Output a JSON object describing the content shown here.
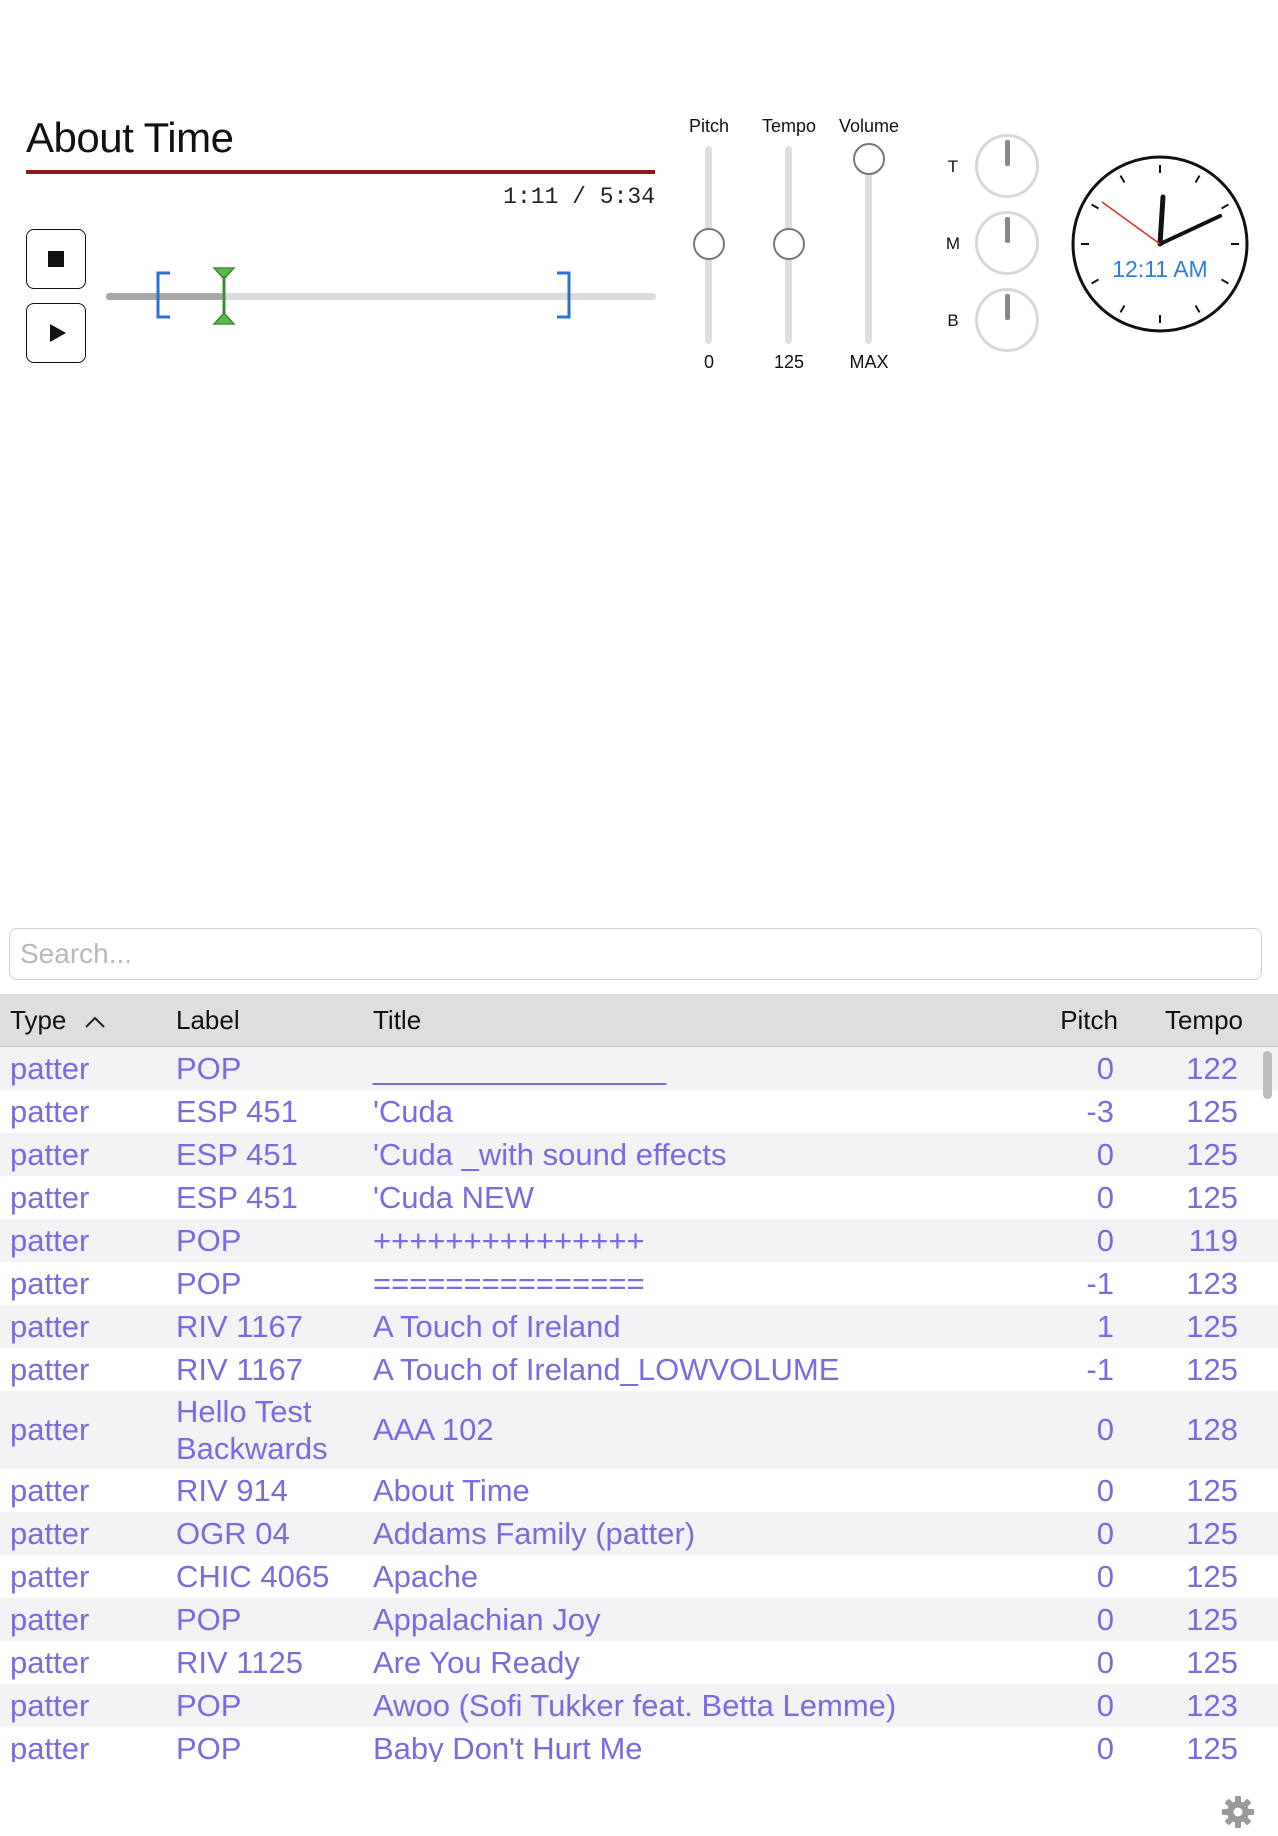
{
  "player": {
    "title": "About Time",
    "time": "1:11 / 5:34",
    "elapsed": "1:11",
    "duration": "5:34",
    "progress_fraction": 0.25,
    "loop_start_fraction": 0.1,
    "loop_end_fraction": 0.84,
    "stop_icon": "stop-icon",
    "play_icon": "play-icon"
  },
  "sliders": [
    {
      "label": "Pitch",
      "value": "0",
      "level": 0.5
    },
    {
      "label": "Tempo",
      "value": "125",
      "level": 0.5
    },
    {
      "label": "Volume",
      "value": "MAX",
      "level": 1.0
    }
  ],
  "eq": [
    {
      "label": "T"
    },
    {
      "label": "M"
    },
    {
      "label": "B"
    }
  ],
  "clock": {
    "time_text": "12:11 AM"
  },
  "search": {
    "placeholder": "Search...",
    "value": ""
  },
  "table": {
    "columns": {
      "type": "Type",
      "label": "Label",
      "title": "Title",
      "pitch": "Pitch",
      "tempo": "Tempo"
    },
    "sort_icon": "chevron-up-icon",
    "rows": [
      {
        "type": "patter",
        "label": "POP",
        "title": "_________________",
        "pitch": "0",
        "tempo": "122"
      },
      {
        "type": "patter",
        "label": "ESP 451",
        "title": "'Cuda",
        "pitch": "-3",
        "tempo": "125"
      },
      {
        "type": "patter",
        "label": "ESP 451",
        "title": "'Cuda _with sound effects",
        "pitch": "0",
        "tempo": "125"
      },
      {
        "type": "patter",
        "label": "ESP 451",
        "title": "'Cuda NEW",
        "pitch": "0",
        "tempo": "125"
      },
      {
        "type": "patter",
        "label": "POP",
        "title": "+++++++++++++++",
        "pitch": "0",
        "tempo": "119"
      },
      {
        "type": "patter",
        "label": "POP",
        "title": "===============",
        "pitch": "-1",
        "tempo": "123"
      },
      {
        "type": "patter",
        "label": "RIV 1167",
        "title": "A Touch of Ireland",
        "pitch": "1",
        "tempo": "125"
      },
      {
        "type": "patter",
        "label": "RIV 1167",
        "title": "A Touch of Ireland_LOWVOLUME",
        "pitch": "-1",
        "tempo": "125"
      },
      {
        "type": "patter",
        "label": "Hello Test Backwards",
        "title": "AAA 102",
        "pitch": "0",
        "tempo": "128"
      },
      {
        "type": "patter",
        "label": "RIV 914",
        "title": "About Time",
        "pitch": "0",
        "tempo": "125"
      },
      {
        "type": "patter",
        "label": "OGR 04",
        "title": "Addams Family (patter)",
        "pitch": "0",
        "tempo": "125"
      },
      {
        "type": "patter",
        "label": "CHIC 4065",
        "title": "Apache",
        "pitch": "0",
        "tempo": "125"
      },
      {
        "type": "patter",
        "label": "POP",
        "title": "Appalachian Joy",
        "pitch": "0",
        "tempo": "125"
      },
      {
        "type": "patter",
        "label": "RIV 1125",
        "title": "Are You Ready",
        "pitch": "0",
        "tempo": "125"
      },
      {
        "type": "patter",
        "label": "POP",
        "title": "Awoo (Sofi Tukker feat. Betta Lemme)",
        "pitch": "0",
        "tempo": "123"
      },
      {
        "type": "patter",
        "label": "POP",
        "title": "Baby Don't Hurt Me",
        "pitch": "0",
        "tempo": "125"
      }
    ]
  },
  "settings_icon": "gear-icon",
  "colors": {
    "accent_text": "#7b6be0",
    "title_rule": "#8b1a1a",
    "loop_marker": "#2f6fd6",
    "playhead": "#4caf3f",
    "clock_text": "#2f7fe0",
    "second_hand": "#e03020"
  }
}
